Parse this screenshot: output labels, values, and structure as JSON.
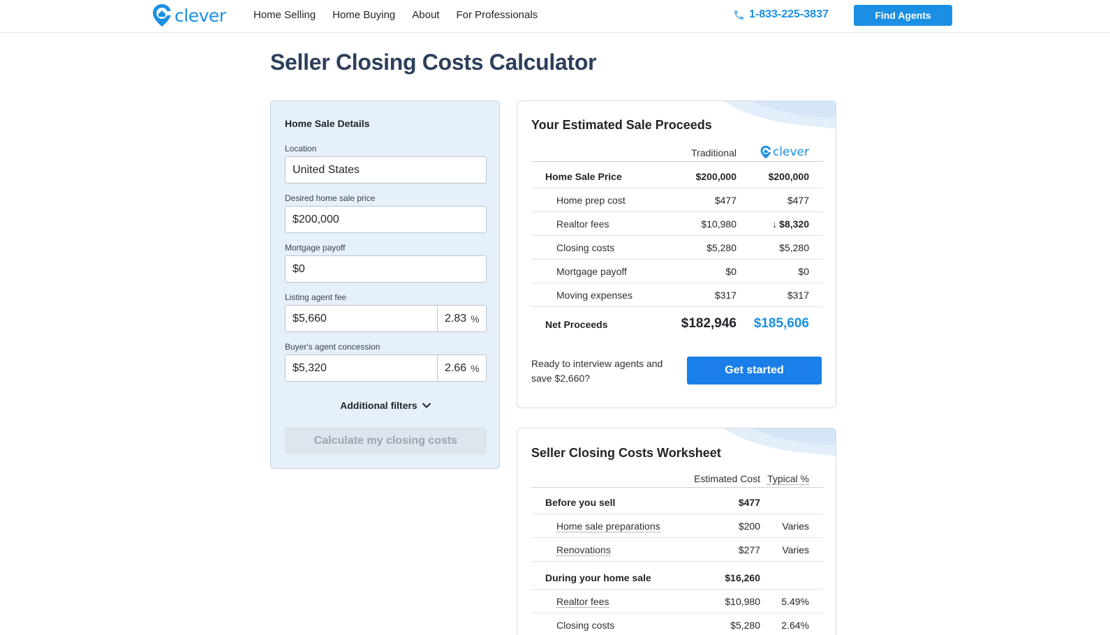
{
  "header": {
    "brand": "clever",
    "nav": [
      "Home Selling",
      "Home Buying",
      "About",
      "For Professionals"
    ],
    "phone": "1-833-225-3837",
    "cta": "Find Agents"
  },
  "page_title": "Seller Closing Costs Calculator",
  "form": {
    "title": "Home Sale Details",
    "location_label": "Location",
    "location_value": "United States",
    "price_label": "Desired home sale price",
    "price_value": "$200,000",
    "mortgage_label": "Mortgage payoff",
    "mortgage_value": "$0",
    "listing_fee_label": "Listing agent fee",
    "listing_fee_value": "$5,660",
    "listing_fee_pct": "2.83",
    "buyer_concession_label": "Buyer's agent concession",
    "buyer_concession_value": "$5,320",
    "buyer_concession_pct": "2.66",
    "pct_symbol": "%",
    "additional_filters": "Additional filters",
    "calculate_button": "Calculate my closing costs"
  },
  "proceeds": {
    "title": "Your Estimated Sale Proceeds",
    "col_traditional": "Traditional",
    "col_clever": "clever",
    "rows": [
      {
        "label": "Home Sale Price",
        "traditional": "$200,000",
        "clever": "$200,000",
        "bold": true
      },
      {
        "label": "Home prep cost",
        "traditional": "$477",
        "clever": "$477"
      },
      {
        "label": "Realtor fees",
        "traditional": "$10,980",
        "clever": "$8,320",
        "clever_down": true
      },
      {
        "label": "Closing costs",
        "traditional": "$5,280",
        "clever": "$5,280"
      },
      {
        "label": "Mortgage payoff",
        "traditional": "$0",
        "clever": "$0"
      },
      {
        "label": "Moving expenses",
        "traditional": "$317",
        "clever": "$317"
      }
    ],
    "net_label": "Net Proceeds",
    "net_traditional": "$182,946",
    "net_clever": "$185,606",
    "ready_text": "Ready to interview agents and save $2,660?",
    "get_started": "Get started"
  },
  "worksheet": {
    "title": "Seller Closing Costs Worksheet",
    "col_estimated": "Estimated Cost",
    "col_typical": "Typical %",
    "rows": [
      {
        "label": "Before you sell",
        "estimated": "$477",
        "typical": "",
        "section": true
      },
      {
        "label": "Home sale preparations",
        "estimated": "$200",
        "typical": "Varies",
        "link": true
      },
      {
        "label": "Renovations",
        "estimated": "$277",
        "typical": "Varies",
        "link": true
      },
      {
        "label": "During your home sale",
        "estimated": "$16,260",
        "typical": "",
        "section": true
      },
      {
        "label": "Realtor fees",
        "estimated": "$10,980",
        "typical": "5.49%",
        "link": true
      },
      {
        "label": "Closing costs",
        "estimated": "$5,280",
        "typical": "2.64%",
        "link": false
      }
    ]
  },
  "colors": {
    "brand_blue": "#1a8fe3",
    "button_blue": "#1a7fe8",
    "panel_bg": "#e6f0fb",
    "title_navy": "#2c3e5a"
  }
}
